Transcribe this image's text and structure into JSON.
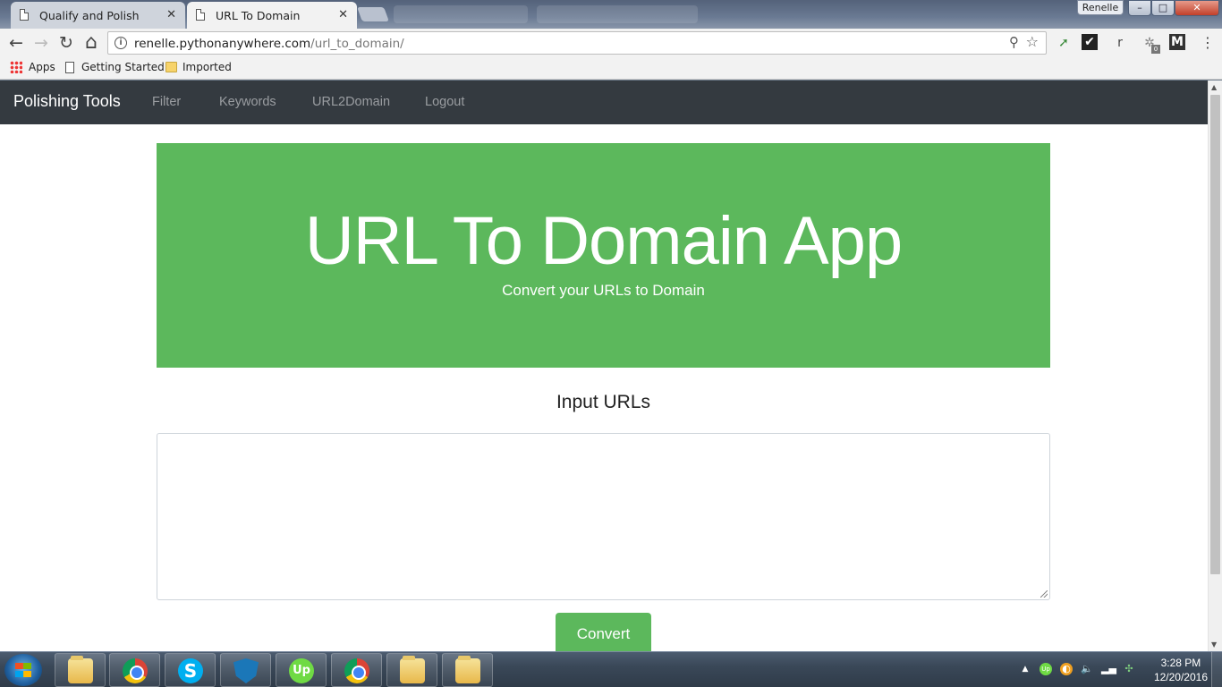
{
  "browser": {
    "tabs": [
      {
        "title": "Qualify and Polish",
        "close": "✕"
      },
      {
        "title": "URL To Domain",
        "close": "✕"
      }
    ],
    "profile_name": "Renelle",
    "window_controls": {
      "minimize": "–",
      "maximize": "□",
      "close": "✕"
    },
    "nav": {
      "back": "←",
      "forward": "→",
      "reload": "↻",
      "home": "⌂"
    },
    "address": {
      "host": "renelle.pythonanywhere.com",
      "path": "/url_to_domain/",
      "info_icon": "i"
    },
    "bookmarks": [
      {
        "label": "Apps",
        "icon": "apps-grid-icon"
      },
      {
        "label": "Getting Started",
        "icon": "page-icon"
      },
      {
        "label": "Imported",
        "icon": "folder-icon"
      }
    ],
    "extension_letter": "r",
    "extension_badge": "0"
  },
  "site": {
    "brand": "Polishing Tools",
    "nav_links": [
      "Filter",
      "Keywords",
      "URL2Domain",
      "Logout"
    ],
    "hero_title": "URL To Domain App",
    "hero_subtitle": "Convert your URLs to Domain",
    "section_title": "Input URLs",
    "input_value": "",
    "convert_label": "Convert",
    "accent_color": "#5cb85c",
    "navbar_color": "#343a40"
  },
  "taskbar": {
    "apps": [
      "windows-explorer",
      "google-chrome",
      "skype",
      "shield-app",
      "upwork",
      "google-chrome",
      "windows-explorer",
      "windows-explorer"
    ],
    "time": "3:28 PM",
    "date": "12/20/2016",
    "upwork_label": "Up",
    "skype_label": "S"
  }
}
